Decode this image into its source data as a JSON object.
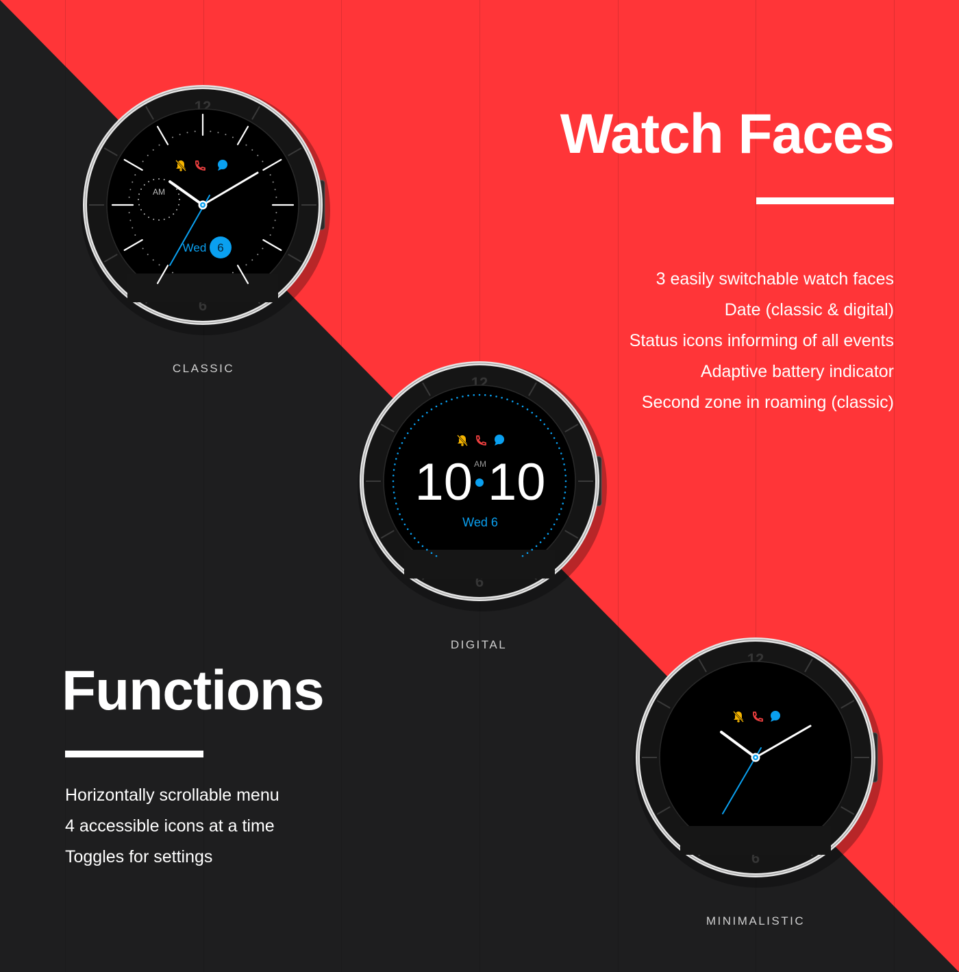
{
  "colors": {
    "background_dark": "#1e1e1f",
    "background_red": "#ff3538",
    "accent_blue": "#0aa0f0",
    "bell_yellow": "#f5b400",
    "phone_red": "#ef4040"
  },
  "watch_faces_section": {
    "heading": "Watch Faces",
    "features": [
      "3 easily switchable watch faces",
      "Date (classic & digital)",
      "Status icons informing of all events",
      "Adaptive battery indicator",
      "Second zone in roaming (classic)"
    ]
  },
  "functions_section": {
    "heading": "Functions",
    "features": [
      "Horizontally scrollable menu",
      "4 accessible icons at a time",
      "Toggles for settings"
    ]
  },
  "watches": {
    "classic": {
      "caption": "CLASSIC",
      "bezel_top": "12",
      "bezel_bottom": "6",
      "status_icons": [
        "bell-muted-icon",
        "phone-icon",
        "chat-icon"
      ],
      "ampm": "AM",
      "day": "Wed",
      "date": "6",
      "time": "10:10"
    },
    "digital": {
      "caption": "DIGITAL",
      "bezel_top": "12",
      "bezel_bottom": "6",
      "status_icons": [
        "bell-muted-icon",
        "phone-icon",
        "chat-icon"
      ],
      "ampm": "AM",
      "hours": "10",
      "minutes": "10",
      "date": "Wed 6"
    },
    "minimalistic": {
      "caption": "MINIMALISTIC",
      "bezel_top": "12",
      "bezel_bottom": "6",
      "status_icons": [
        "bell-muted-icon",
        "phone-icon",
        "chat-icon"
      ],
      "time": "10:10"
    }
  }
}
